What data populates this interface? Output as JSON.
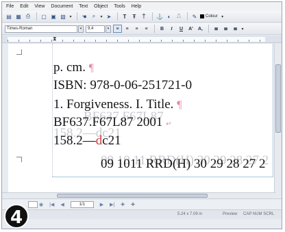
{
  "menu": [
    "File",
    "Edit",
    "View",
    "Document",
    "Text",
    "Object",
    "Tools",
    "Help"
  ],
  "toolbar1": {
    "icons": [
      "new-icon",
      "open-icon",
      "print-icon",
      "page-icon",
      "copy-icon",
      "paste-icon"
    ],
    "colour_label": "Colour"
  },
  "toolbar2": {
    "font": "Times-Roman",
    "size": "9.4",
    "format_buttons": [
      "B",
      "I",
      "U",
      "A'",
      "A,"
    ]
  },
  "document": {
    "lines": [
      {
        "text": "p.  cm.",
        "mark": "¶"
      },
      {
        "text": "ISBN: 978-0-06-251721-0",
        "mark": ""
      },
      {
        "text": "1. Forgiveness.   I. Title.",
        "mark": "¶"
      },
      {
        "text": "BF637.F67L87  2001",
        "mark": "↵"
      }
    ],
    "line5_prefix": "158.2—",
    "line5_red": "d",
    "line5_suffix": "c21",
    "line6": "09 1011 RRD(H) 30 29 28 27 2",
    "ghost_line1": "BF637.F67L87",
    "ghost_line2": "158.2—dc21",
    "ghost_line3": "09 10 11 RRD(H) 30 29 28 27 2"
  },
  "navbar": {
    "page": "1/1"
  },
  "statusbar": {
    "dimensions": "5.24 x 7.09 in",
    "mode": "Preview",
    "indicators": "CAP  NUM  SCRL"
  },
  "badge": "4"
}
